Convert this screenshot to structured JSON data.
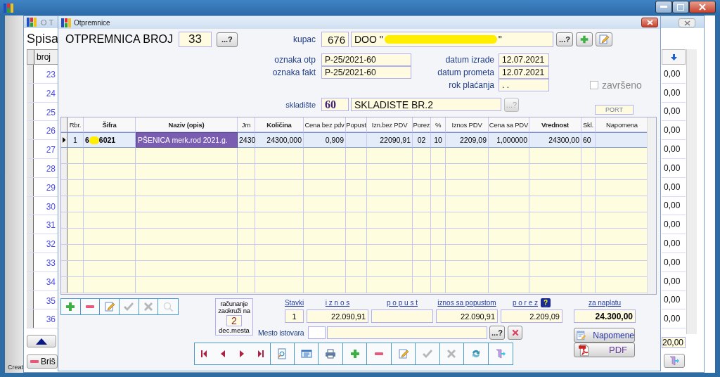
{
  "app_window": {
    "status": "Creat"
  },
  "list_window": {
    "title": "O T",
    "heading": "Spisa",
    "column": "broj",
    "numbers": [
      "23",
      "24",
      "25",
      "26",
      "27",
      "28",
      "29",
      "30",
      "31",
      "32",
      "33",
      "34",
      "35",
      "36"
    ],
    "amounts": [
      "0,00",
      "0,00",
      "0,00",
      "0,00",
      "0,00",
      "0,00",
      "0,00",
      "0,00",
      "0,00",
      "0,00",
      "0,00",
      "0,00",
      "0,00",
      "0,00"
    ],
    "total": "20,00",
    "delete_button": "Briš"
  },
  "dialog": {
    "title": "Otpremnice",
    "heading": "OTPREMNICA BROJ",
    "number": "33",
    "number_lookup": "...?",
    "customer": {
      "label": "kupac",
      "code": "676",
      "name": "DOO \"",
      "name_end": "\"",
      "lookup": "...?"
    },
    "references": [
      {
        "label": "oznaka otp",
        "value": "P-25/2021-60"
      },
      {
        "label": "oznaka fakt",
        "value": "P-25/2021-60"
      }
    ],
    "dates": [
      {
        "label": "datum izrade",
        "value": "12.07.2021"
      },
      {
        "label": "datum prometa",
        "value": "12.07.2021"
      },
      {
        "label": "rok plaćanja",
        "value": ".  ."
      }
    ],
    "finished": {
      "label": "završeno",
      "checked": false,
      "disabled": true
    },
    "warehouse": {
      "label": "skladište",
      "code": "60",
      "name": "SKLADISTE BR.2",
      "lookup": "...?",
      "lookup_disabled": true
    },
    "port": "PORT",
    "table": {
      "columns": [
        {
          "label": "Rbr.",
          "bold": false
        },
        {
          "label": "Šifra",
          "bold": true
        },
        {
          "label": "Naziv (opis)",
          "bold": true
        },
        {
          "label": "Jm",
          "bold": false
        },
        {
          "label": "Količina",
          "bold": true
        },
        {
          "label": "Cena bez pdv",
          "bold": false
        },
        {
          "label": "Popust",
          "bold": false
        },
        {
          "label": "Izn.bez PDV",
          "bold": false
        },
        {
          "label": "Porez",
          "bold": false
        },
        {
          "label": "%",
          "bold": false
        },
        {
          "label": "Iznos PDV",
          "bold": false
        },
        {
          "label": "Cena sa PDV",
          "bold": false
        },
        {
          "label": "Vrednost",
          "bold": true
        },
        {
          "label": "Skl.",
          "bold": false
        },
        {
          "label": "Napomena",
          "bold": false
        }
      ],
      "rows": [
        {
          "selected": true,
          "cells": [
            {
              "text": "1"
            },
            {
              "start": "6",
              "end": "6021"
            },
            {
              "text": "PŠENICA merk.rod 2021.g.",
              "editing": true
            },
            {
              "text": "2430"
            },
            {
              "text": "24300,000"
            },
            {
              "text": "0,909"
            },
            null,
            {
              "text": "22090,91"
            },
            {
              "text": "02"
            },
            {
              "text": "10"
            },
            {
              "text": "2209,09"
            },
            {
              "text": "1,000000"
            },
            {
              "text": "24300,00"
            },
            {
              "text": "60"
            },
            null
          ]
        }
      ]
    },
    "row_tools": [
      {
        "kind": "add",
        "disabled": false
      },
      {
        "kind": "remove",
        "disabled": false
      },
      {
        "kind": "edit",
        "disabled": false
      },
      {
        "kind": "confirm",
        "disabled": true
      },
      {
        "kind": "cancel",
        "disabled": true
      },
      {
        "kind": "search",
        "disabled": true
      }
    ],
    "rounding": {
      "caption": "računanje zaokruži na",
      "digits": "2",
      "unit": "dec.mesta"
    },
    "totals": [
      {
        "label": "Stavki",
        "value": "1"
      },
      {
        "label": "i z n o s",
        "value": "22.090,91"
      },
      {
        "label": "p o p u s t"
      },
      {
        "label": "iznos sa popustom",
        "value": "22.090,91"
      },
      {
        "label": "p o r e z",
        "value": "2.209,09",
        "help": "?"
      }
    ],
    "to_pay": {
      "label": "za naplatu",
      "value": "24.300,00"
    },
    "unloading": {
      "label": "Mesto istovara",
      "lookup": "...?"
    },
    "side_buttons": [
      {
        "kind": "notes",
        "label": "Napomene"
      },
      {
        "kind": "pdf",
        "label": "PDF"
      }
    ],
    "navigation": [
      {
        "kind": "first",
        "disabled": false
      },
      {
        "kind": "previous",
        "disabled": false
      },
      {
        "kind": "next",
        "disabled": false
      },
      {
        "kind": "last",
        "disabled": false
      },
      {
        "kind": "preview",
        "disabled": false
      },
      {
        "kind": "form",
        "disabled": false
      },
      {
        "kind": "print",
        "disabled": false
      },
      {
        "kind": "add",
        "disabled": false
      },
      {
        "kind": "remove",
        "disabled": false
      },
      {
        "kind": "edit",
        "disabled": false
      },
      {
        "kind": "confirm",
        "disabled": true
      },
      {
        "kind": "cancel",
        "disabled": true
      },
      {
        "kind": "refresh",
        "disabled": false
      },
      {
        "kind": "exit",
        "disabled": false
      }
    ]
  }
}
